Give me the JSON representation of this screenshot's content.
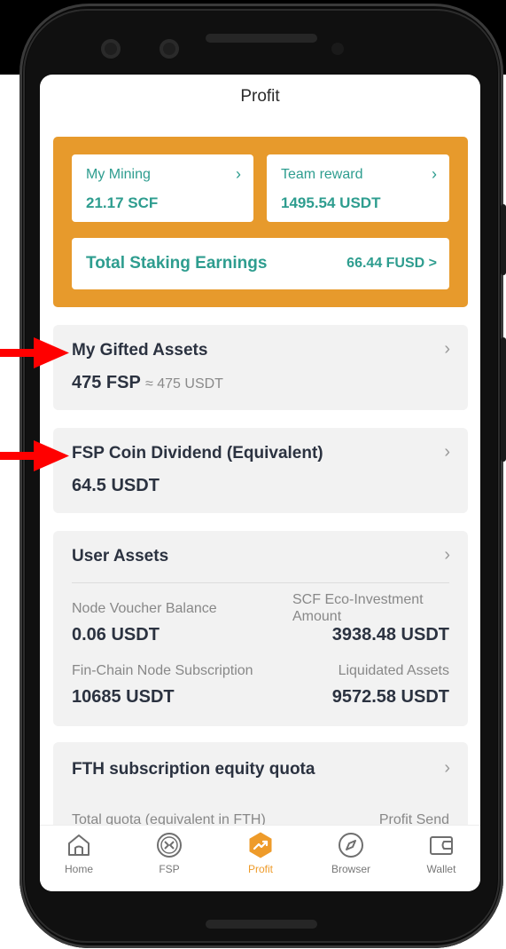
{
  "header": {
    "title": "Profit"
  },
  "summary": {
    "my_mining": {
      "label": "My Mining",
      "value": "21.17 SCF"
    },
    "team_reward": {
      "label": "Team reward",
      "value": "1495.54 USDT"
    },
    "total_staking": {
      "label": "Total Staking Earnings",
      "value": "66.44 FUSD >"
    }
  },
  "gifted_assets": {
    "title": "My Gifted Assets",
    "value": "475 FSP",
    "equivalent": "≈ 475 USDT"
  },
  "coin_dividend": {
    "title": "FSP Coin Dividend (Equivalent)",
    "value": "64.5 USDT"
  },
  "user_assets": {
    "title": "User Assets",
    "node_voucher": {
      "label": "Node Voucher Balance",
      "value": "0.06 USDT"
    },
    "scf_eco": {
      "label_line1": "SCF Eco-Investment",
      "label_line2": "Amount",
      "value": "3938.48 USDT"
    },
    "fin_chain": {
      "label": "Fin-Chain Node Subscription",
      "value": "10685 USDT"
    },
    "liquidated": {
      "label": "Liquidated Assets",
      "value": "9572.58 USDT"
    }
  },
  "fth": {
    "title": "FTH subscription equity quota",
    "total_quota_label": "Total quota (equivalent in FTH)",
    "profit_send_label": "Profit Send"
  },
  "nav": {
    "items": [
      {
        "label": "Home",
        "icon": "home-icon"
      },
      {
        "label": "FSP",
        "icon": "fsp-icon"
      },
      {
        "label": "Profit",
        "icon": "profit-icon",
        "active": true
      },
      {
        "label": "Browser",
        "icon": "compass-icon"
      },
      {
        "label": "Wallet",
        "icon": "wallet-icon"
      }
    ]
  },
  "colors": {
    "accent_orange": "#e79a2c",
    "teal": "#2e9d8f",
    "text_dark": "#2b3240",
    "annotation_red": "#ff0000"
  }
}
